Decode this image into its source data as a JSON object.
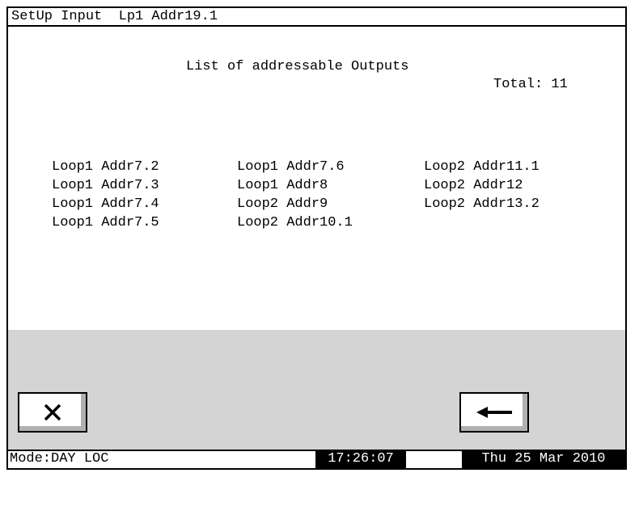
{
  "title": "SetUp Input  Lp1 Addr19.1",
  "list": {
    "heading": "List of addressable Outputs",
    "total_label": "Total: 11"
  },
  "outputs": {
    "col1": [
      "Loop1 Addr7.2",
      "Loop1 Addr7.3",
      "Loop1 Addr7.4",
      "Loop1 Addr7.5"
    ],
    "col2": [
      "Loop1 Addr7.6",
      "Loop1 Addr8",
      "Loop2 Addr9",
      "Loop2 Addr10.1"
    ],
    "col3": [
      "Loop2 Addr11.1",
      "Loop2 Addr12",
      "Loop2 Addr13.2"
    ]
  },
  "buttons": {
    "close_icon": "close-icon",
    "back_icon": "arrow-left-icon"
  },
  "status": {
    "mode": "Mode:DAY LOC",
    "time": "17:26:07",
    "date": "Thu 25 Mar 2010"
  },
  "colors": {
    "panel": "#d4d4d4",
    "text": "#000000",
    "status_highlight": "#000000"
  }
}
